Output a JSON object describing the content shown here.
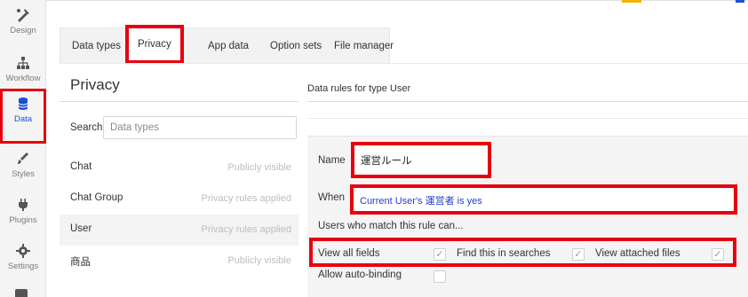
{
  "rail": {
    "items": [
      {
        "label": "Design",
        "icon": "design-icon"
      },
      {
        "label": "Workflow",
        "icon": "workflow-icon"
      },
      {
        "label": "Data",
        "icon": "database-icon"
      },
      {
        "label": "Styles",
        "icon": "brush-icon"
      },
      {
        "label": "Plugins",
        "icon": "plug-icon"
      },
      {
        "label": "Settings",
        "icon": "gear-icon"
      }
    ]
  },
  "tabs": [
    {
      "label": "Data types"
    },
    {
      "label": "Privacy"
    },
    {
      "label": "App data"
    },
    {
      "label": "Option sets"
    },
    {
      "label": "File manager"
    }
  ],
  "privacy": {
    "title": "Privacy",
    "search_label": "Search",
    "search_placeholder": "Data types",
    "types": [
      {
        "name": "Chat",
        "status": "Publicly visible"
      },
      {
        "name": "Chat Group",
        "status": "Privacy rules applied"
      },
      {
        "name": "User",
        "status": "Privacy rules applied"
      },
      {
        "name": "商品",
        "status": "Publicly visible"
      }
    ]
  },
  "rules": {
    "header": "Data rules for type User",
    "name_label": "Name",
    "name_value": "運営ルール",
    "when_label": "When",
    "when_value": "Current User's 運営者 is yes",
    "users_label": "Users who match this rule can...",
    "permissions": [
      {
        "label": "View all fields",
        "checked": true
      },
      {
        "label": "Find this in searches",
        "checked": true
      },
      {
        "label": "View attached files",
        "checked": true
      }
    ],
    "auto_binding_label": "Allow auto-binding",
    "auto_binding_checked": false
  },
  "colors": {
    "highlight": "#e8000d",
    "link": "#1f3ecb",
    "active_nav": "#1a4fd6"
  }
}
